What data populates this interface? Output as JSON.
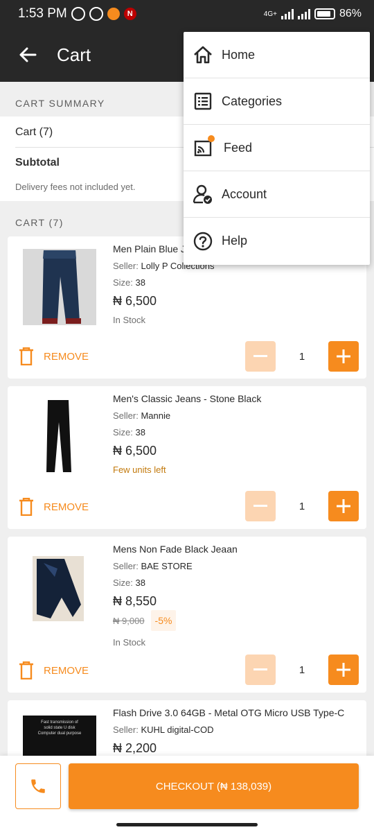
{
  "status_bar": {
    "time": "1:53 PM",
    "network": "4G+",
    "battery": "86%",
    "battery_level": 0.86
  },
  "app_bar": {
    "title": "Cart"
  },
  "summary": {
    "heading": "CART SUMMARY",
    "cart_count_label": "Cart (7)",
    "subtotal_label": "Subtotal",
    "delivery_note": "Delivery fees not included yet."
  },
  "cart": {
    "heading": "CART (7)",
    "remove_label": "REMOVE",
    "seller_prefix": "Seller: ",
    "size_prefix": "Size: ",
    "items": [
      {
        "name": "Men Plain Blue Jeans",
        "seller": "Lolly P Collections",
        "size": "38",
        "price": "₦ 6,500",
        "stock": "In Stock",
        "quantity": "1"
      },
      {
        "name": "Men's Classic Jeans - Stone Black",
        "seller": "Mannie",
        "size": "38",
        "price": "₦ 6,500",
        "stock": "Few units left",
        "quantity": "1"
      },
      {
        "name": "Mens Non Fade  Black Jeaan",
        "seller": "BAE STORE",
        "size": "38",
        "price": "₦ 8,550",
        "old_price": "₦ 9,000",
        "discount": "-5%",
        "stock": "In Stock",
        "quantity": "1"
      },
      {
        "name": "Flash Drive 3.0 64GB - Metal OTG Micro USB Type-C",
        "seller": "KUHL digital-COD",
        "price": "₦ 2,200",
        "image_text": "Fast transmission of\nsolid state U disk\nComputer dual purpose"
      }
    ]
  },
  "bottom_bar": {
    "checkout_label": "CHECKOUT (₦ 138,039)"
  },
  "menu": {
    "items": [
      {
        "label": "Home",
        "icon": "home-icon"
      },
      {
        "label": "Categories",
        "icon": "categories-icon"
      },
      {
        "label": "Feed",
        "icon": "feed-icon"
      },
      {
        "label": "Account",
        "icon": "account-icon"
      },
      {
        "label": "Help",
        "icon": "help-icon"
      }
    ]
  },
  "colors": {
    "accent": "#f68b1e",
    "accent_light": "#fcd5b2",
    "dark": "#282828",
    "background": "#efefef"
  }
}
